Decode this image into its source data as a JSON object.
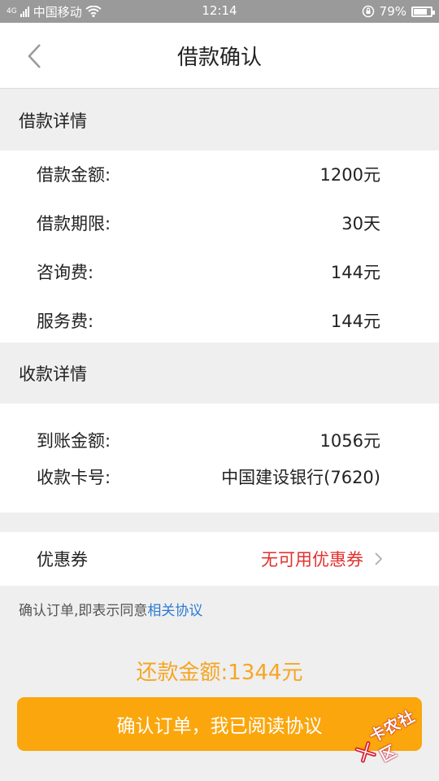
{
  "status_bar": {
    "signal_label": "4G",
    "carrier": "中国移动",
    "time": "12:14",
    "battery_percent": "79%",
    "battery_level": 0.79
  },
  "nav": {
    "title": "借款确认",
    "back_icon": "chevron-left-icon"
  },
  "loan_details": {
    "header": "借款详情",
    "rows": [
      {
        "label": "借款金额:",
        "value": "1200元"
      },
      {
        "label": "借款期限:",
        "value": "30天"
      },
      {
        "label": "咨询费:",
        "value": "144元"
      },
      {
        "label": "服务费:",
        "value": "144元"
      }
    ]
  },
  "receipt_details": {
    "header": "收款详情",
    "rows": [
      {
        "label": "到账金额:",
        "value": "1056元"
      },
      {
        "label": "收款卡号:",
        "value": "中国建设银行(7620)"
      }
    ]
  },
  "coupon": {
    "label": "优惠券",
    "value": "无可用优惠券"
  },
  "agreement": {
    "prefix": "确认订单,即表示同意",
    "link": "相关协议"
  },
  "repay": {
    "text": "还款金额:1344元"
  },
  "confirm_button": {
    "label": "确认订单，我已阅读协议"
  },
  "watermark": {
    "text": "卡农社区"
  },
  "colors": {
    "accent": "#faa60c",
    "repay_text": "#f5a623",
    "coupon_text": "#e2312f",
    "link": "#2b7bd0",
    "status_bar": "#9a9a9a"
  }
}
